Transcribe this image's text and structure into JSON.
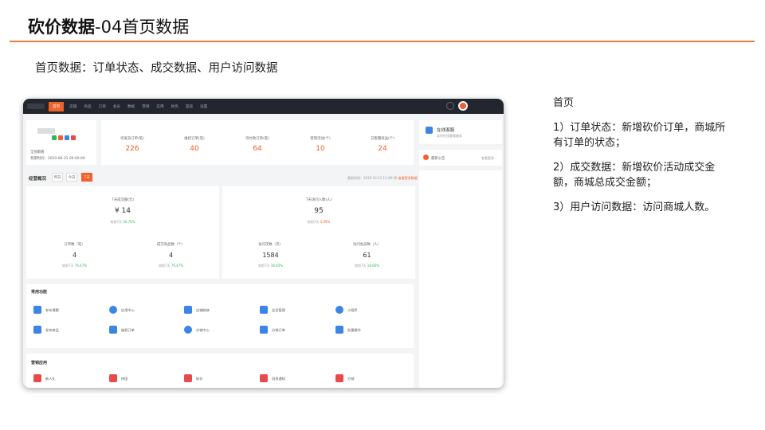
{
  "slide": {
    "title_bold": "砍价数据",
    "title_rest": "-04首页数据",
    "subtitle": "首页数据：订单状态、成交数据、用户访问数据"
  },
  "screenshot": {
    "nav": [
      "首页",
      "店铺",
      "商品",
      "订单",
      "会员",
      "数据",
      "营销",
      "应用",
      "财务",
      "渠道",
      "设置"
    ],
    "active_nav_index": 0,
    "store": {
      "line1": "全部都看",
      "line2": "到期时间：2020-06-31 00:00:00"
    },
    "order_status": [
      {
        "label": "待发货订单(笔)",
        "value": "226"
      },
      {
        "label": "维权订单(笔)",
        "value": "40"
      },
      {
        "label": "待付款订单(笔)",
        "value": "64"
      },
      {
        "label": "营销活动(个)",
        "value": "10"
      },
      {
        "label": "已售罄商品(个)",
        "value": "24"
      }
    ],
    "service": {
      "title": "在线客服",
      "sub": "实时在线客服服务"
    },
    "notice": {
      "title": "最新公告",
      "more": "查看更多"
    },
    "overview": {
      "title": "经营概况",
      "tabs": [
        "昨日",
        "今日",
        "7天"
      ],
      "active_tab_index": 2,
      "updated": "更新时间：2019-10-11 11:49:36",
      "more_link": "查看更多数据"
    },
    "deal": {
      "heading": "7天成交额(元)",
      "value": "¥ 14",
      "compare_label": "较前7天",
      "compare_value": "46.76%",
      "subs": [
        {
          "label": "订单数（笔）",
          "value": "4",
          "compare": "较前7天",
          "delta": "76.47%"
        },
        {
          "label": "成交商品数（个）",
          "value": "4",
          "compare": "较前7天",
          "delta": "76.47%"
        }
      ]
    },
    "visits": {
      "heading": "7天访问人数(人)",
      "value": "95",
      "compare_label": "较前7天",
      "compare_value": "4.09%",
      "subs": [
        {
          "label": "访问次数（次）",
          "value": "1584",
          "compare": "较前7天",
          "delta": "16.65%"
        },
        {
          "label": "访问会员数（人）",
          "value": "61",
          "compare": "较前7天",
          "delta": "18.66%"
        }
      ]
    },
    "functions": {
      "title": "常用功能",
      "items": [
        "发布课题",
        "应用中心",
        "店铺装修",
        "会员管理",
        "小程序",
        "发布商品",
        "维权订单",
        "分销中心",
        "分销订单",
        "批量操作"
      ]
    },
    "marketing": {
      "title": "营销应用",
      "items": [
        "新人礼",
        "拼团",
        "砍价",
        "消息通知",
        "分销"
      ]
    },
    "colors": {
      "accent": "#f0602a",
      "topbar": "#23262e",
      "icon_blue": "#3c84e6",
      "up_green": "#2db85b"
    }
  },
  "notes": {
    "heading": "首页",
    "p1": "1）订单状态：新增砍价订单，商城所有订单的状态；",
    "p2": "2）成交数据：新增砍价活动成交金额，商城总成交金额；",
    "p3": "3）用户访问数据：访问商城人数。"
  }
}
